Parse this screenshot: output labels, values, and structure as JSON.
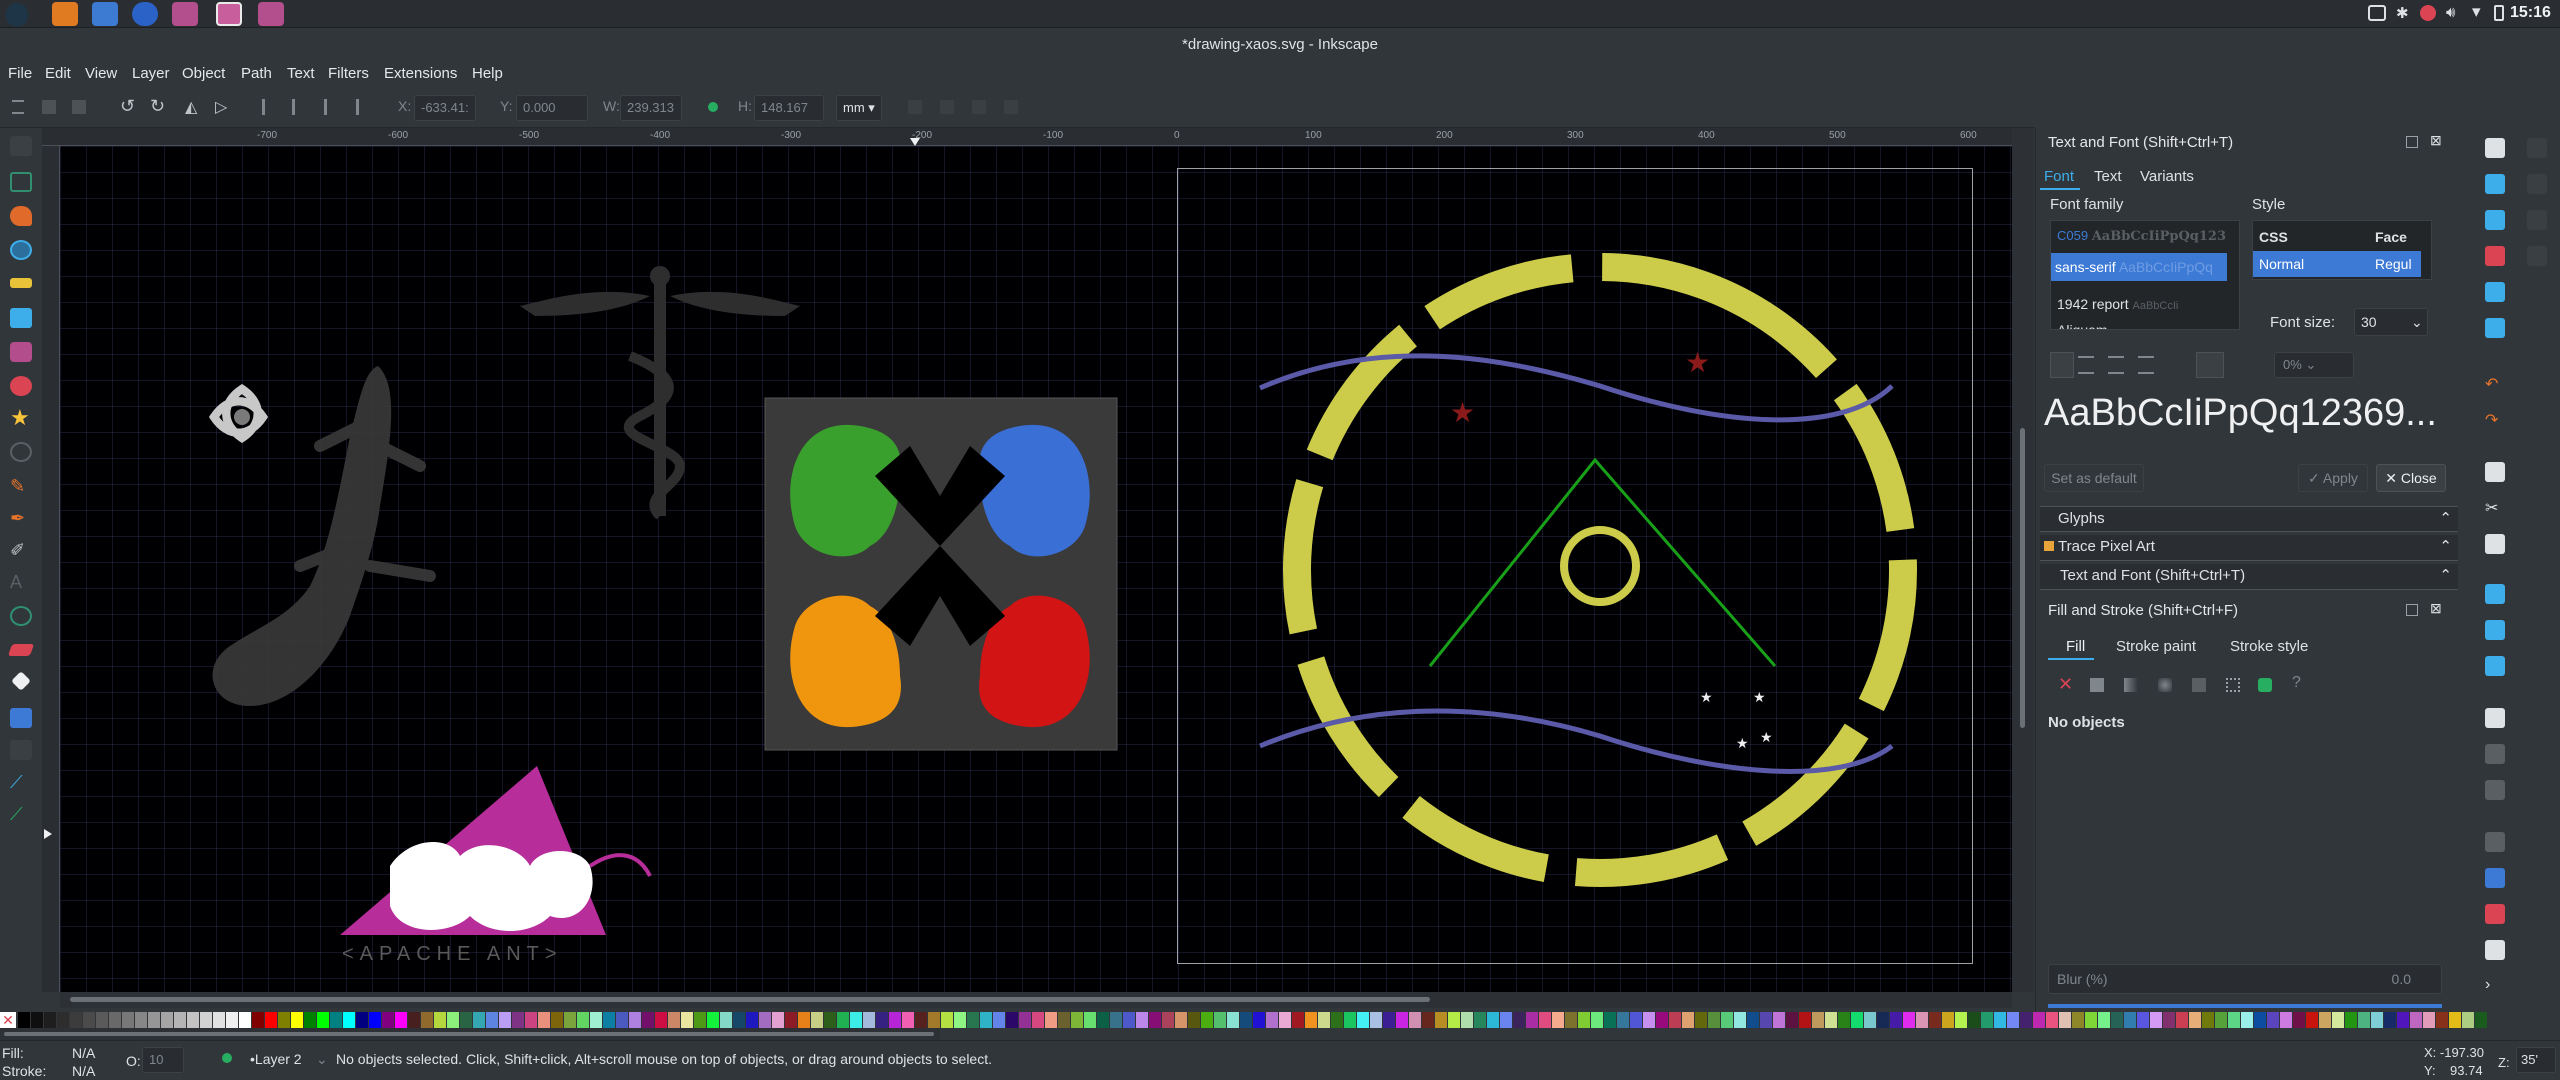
{
  "taskbar": {
    "time": "15:16"
  },
  "window": {
    "title": "*drawing-xaos.svg - Inkscape"
  },
  "menu": [
    "File",
    "Edit",
    "View",
    "Layer",
    "Object",
    "Path",
    "Text",
    "Filters",
    "Extensions",
    "Help"
  ],
  "controls": {
    "x_label": "X:",
    "x_value": "-633.41:",
    "y_label": "Y:",
    "y_value": "0.000",
    "w_label": "W:",
    "w_value": "239.313",
    "h_label": "H:",
    "h_value": "148.167",
    "unit": "mm"
  },
  "ruler": {
    "labels": [
      "-700",
      "-600",
      "-500",
      "-400",
      "-300",
      "-200",
      "-100",
      "0",
      "100",
      "200",
      "300",
      "400",
      "500",
      "600"
    ]
  },
  "canvas": {
    "ant_text": "<APACHE ANT>"
  },
  "text_font_panel": {
    "title": "Text and Font (Shift+Ctrl+T)",
    "tabs": [
      "Font",
      "Text",
      "Variants"
    ],
    "font_family_label": "Font family",
    "style_label": "Style",
    "fonts": [
      {
        "name": "C059",
        "preview": "AaBbCcIiPpQq123"
      },
      {
        "name": "sans-serif",
        "preview": "AaBbCcIiPpQq"
      },
      {
        "name": "1942 report",
        "preview": "AaBbCcIi"
      },
      {
        "name": "Aliquam",
        "preview": ""
      }
    ],
    "style_header_css": "CSS",
    "style_header_face": "Face",
    "style_selected_css": "Normal",
    "style_selected_face": "Regul",
    "font_size_label": "Font size:",
    "font_size_value": "30",
    "spacing_value": "0%",
    "preview_text": "AaBbCcIiPpQq12369...",
    "set_default": "Set as default",
    "apply": "Apply",
    "close": "Close"
  },
  "collapsed_panels": {
    "glyphs": "Glyphs",
    "trace": "Trace Pixel Art",
    "text_font": "Text and Font (Shift+Ctrl+T)"
  },
  "fill_stroke_panel": {
    "title": "Fill and Stroke (Shift+Ctrl+F)",
    "tabs": [
      "Fill",
      "Stroke paint",
      "Stroke style"
    ],
    "no_objects": "No objects",
    "blur_label": "Blur (%)",
    "blur_value": "0.0"
  },
  "status": {
    "fill_label": "Fill:",
    "fill_value": "N/A",
    "stroke_label": "Stroke:",
    "stroke_value": "N/A",
    "opacity_label": "O:",
    "opacity_value": "10",
    "layer": "•Layer 2",
    "message": "No objects selected. Click, Shift+click, Alt+scroll mouse on top of objects, or drag around objects to select.",
    "x_coord": "X: -197.30",
    "y_coord": "Y:    93.74",
    "zoom_label": "Z:",
    "zoom_value": "35'"
  },
  "colors": {
    "accent": "#3daee9",
    "selection": "#3d7ad6",
    "bg": "#31363b",
    "canvas": "#000003"
  }
}
